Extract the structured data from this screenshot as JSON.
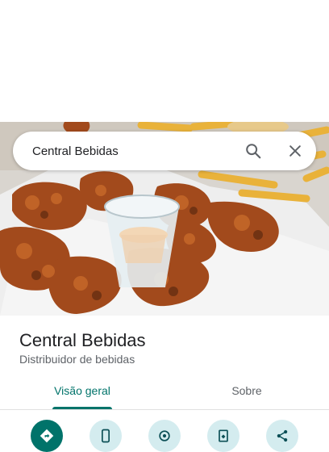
{
  "search": {
    "query": "Central Bebidas"
  },
  "place": {
    "title": "Central Bebidas",
    "category": "Distribuidor de bebidas"
  },
  "tabs": [
    {
      "label": "Visão geral",
      "active": true
    },
    {
      "label": "Sobre",
      "active": false
    }
  ],
  "actions": [
    {
      "name": "directions-icon",
      "primary": true
    },
    {
      "name": "phone-icon",
      "primary": false
    },
    {
      "name": "website-icon",
      "primary": false
    },
    {
      "name": "save-icon",
      "primary": false
    },
    {
      "name": "share-icon",
      "primary": false
    }
  ],
  "colors": {
    "accent": "#00736a",
    "secondary_button_bg": "#d4ecef",
    "title_text": "#202124",
    "subtitle_text": "#5f6368"
  },
  "hero_image": {
    "icon": "food-photo"
  }
}
